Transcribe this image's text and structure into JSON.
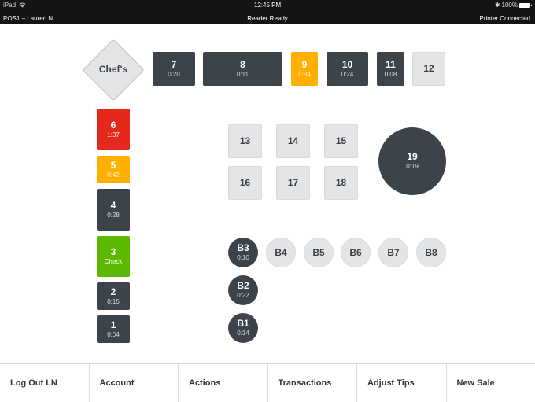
{
  "status_bar": {
    "device": "iPad",
    "time": "12:45 PM",
    "battery": "100%",
    "device_label": "POS1 – Lauren N.",
    "reader_status": "Reader Ready",
    "printer_status": "Printer Connected"
  },
  "floor": {
    "chefs_label": "Chef's",
    "top_row": [
      {
        "num": "7",
        "time": "0:20",
        "state": "dark"
      },
      {
        "num": "8",
        "time": "0:11",
        "state": "dark"
      },
      {
        "num": "9",
        "time": "0:34",
        "state": "yellow"
      },
      {
        "num": "10",
        "time": "0:24",
        "state": "dark"
      },
      {
        "num": "11",
        "time": "0:08",
        "state": "dark"
      },
      {
        "num": "12",
        "time": "",
        "state": "empty"
      }
    ],
    "left_column": [
      {
        "num": "6",
        "time": "1:07",
        "state": "red"
      },
      {
        "num": "5",
        "time": "0:42",
        "state": "yellow"
      },
      {
        "num": "4",
        "time": "0:28",
        "state": "dark"
      },
      {
        "num": "3",
        "time": "Check",
        "state": "green"
      },
      {
        "num": "2",
        "time": "0:15",
        "state": "dark"
      },
      {
        "num": "1",
        "time": "0:04",
        "state": "dark"
      }
    ],
    "grid": [
      {
        "num": "13"
      },
      {
        "num": "14"
      },
      {
        "num": "15"
      },
      {
        "num": "16"
      },
      {
        "num": "17"
      },
      {
        "num": "18"
      }
    ],
    "big_round": {
      "num": "19",
      "time": "0:19",
      "state": "dark"
    },
    "bar_seats": [
      {
        "num": "B3",
        "time": "0:10",
        "state": "dark"
      },
      {
        "num": "B4",
        "time": "",
        "state": "empty"
      },
      {
        "num": "B5",
        "time": "",
        "state": "empty"
      },
      {
        "num": "B6",
        "time": "",
        "state": "empty"
      },
      {
        "num": "B7",
        "time": "",
        "state": "empty"
      },
      {
        "num": "B8",
        "time": "",
        "state": "empty"
      },
      {
        "num": "B2",
        "time": "0:22",
        "state": "dark"
      },
      {
        "num": "B1",
        "time": "0:14",
        "state": "dark"
      }
    ]
  },
  "colors": {
    "occupied": "#3c434a",
    "empty": "#e4e5e7",
    "warning": "#ffb000",
    "overdue": "#e5281c",
    "check": "#5cb800"
  },
  "bottom_bar": [
    {
      "label": "Log Out LN"
    },
    {
      "label": "Account"
    },
    {
      "label": "Actions"
    },
    {
      "label": "Transactions"
    },
    {
      "label": "Adjust Tips"
    },
    {
      "label": "New Sale"
    }
  ]
}
